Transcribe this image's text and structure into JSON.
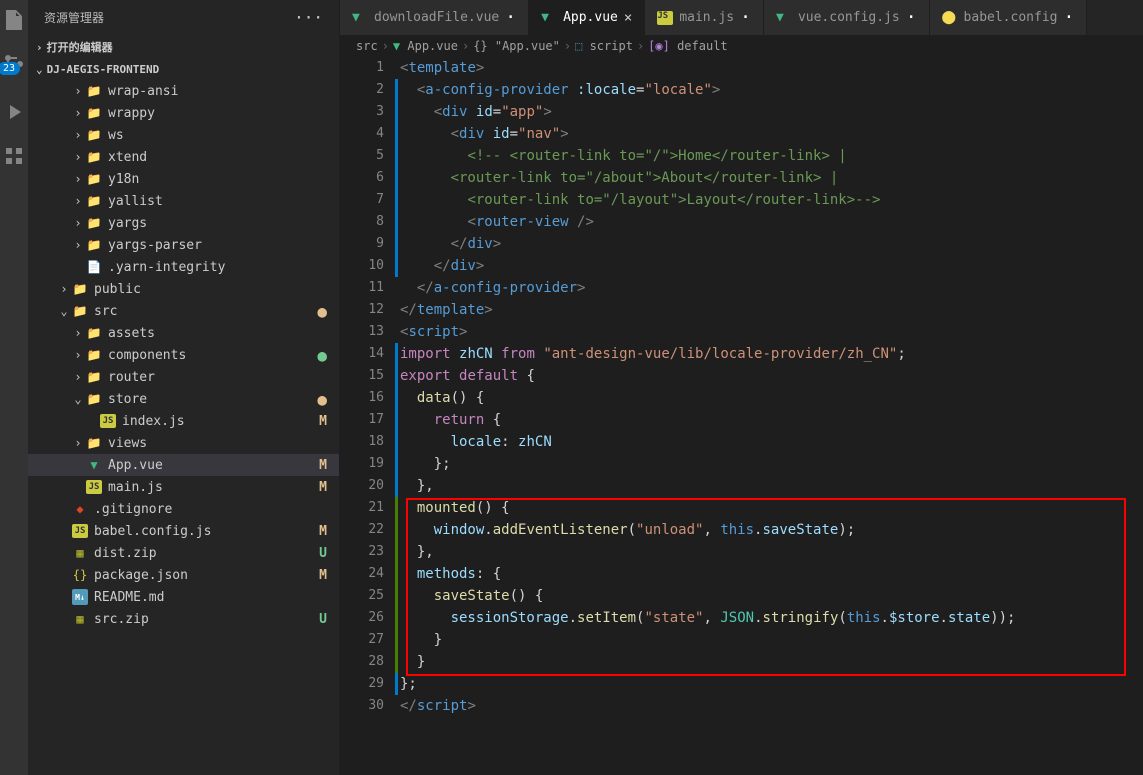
{
  "sidebar_title": "资源管理器",
  "open_editors": "打开的编辑器",
  "project": "DJ-AEGIS-FRONTEND",
  "badge": "23",
  "tree": [
    {
      "label": "wrap-ansi",
      "depth": 3,
      "chev": "›",
      "icon": "folder"
    },
    {
      "label": "wrappy",
      "depth": 3,
      "chev": "›",
      "icon": "folder"
    },
    {
      "label": "ws",
      "depth": 3,
      "chev": "›",
      "icon": "folder"
    },
    {
      "label": "xtend",
      "depth": 3,
      "chev": "›",
      "icon": "folder"
    },
    {
      "label": "y18n",
      "depth": 3,
      "chev": "›",
      "icon": "folder"
    },
    {
      "label": "yallist",
      "depth": 3,
      "chev": "›",
      "icon": "folder"
    },
    {
      "label": "yargs",
      "depth": 3,
      "chev": "›",
      "icon": "folder"
    },
    {
      "label": "yargs-parser",
      "depth": 3,
      "chev": "›",
      "icon": "folder"
    },
    {
      "label": ".yarn-integrity",
      "depth": 3,
      "chev": "",
      "icon": "file",
      "iconColor": "#519aba"
    },
    {
      "label": "public",
      "depth": 2,
      "chev": "›",
      "icon": "folder-green"
    },
    {
      "label": "src",
      "depth": 2,
      "chev": "⌄",
      "icon": "folder-green",
      "status": "dot"
    },
    {
      "label": "assets",
      "depth": 3,
      "chev": "›",
      "icon": "folder-orange"
    },
    {
      "label": "components",
      "depth": 3,
      "chev": "›",
      "icon": "folder-orange",
      "status": "gdot"
    },
    {
      "label": "router",
      "depth": 3,
      "chev": "›",
      "icon": "folder-orange"
    },
    {
      "label": "store",
      "depth": 3,
      "chev": "⌄",
      "icon": "folder-orange",
      "status": "dot"
    },
    {
      "label": "index.js",
      "depth": 4,
      "chev": "",
      "icon": "js",
      "status": "M"
    },
    {
      "label": "views",
      "depth": 3,
      "chev": "›",
      "icon": "folder-orange"
    },
    {
      "label": "App.vue",
      "depth": 3,
      "chev": "",
      "icon": "vue",
      "status": "M",
      "selected": true
    },
    {
      "label": "main.js",
      "depth": 3,
      "chev": "",
      "icon": "js",
      "status": "M"
    },
    {
      "label": ".gitignore",
      "depth": 2,
      "chev": "",
      "icon": "git"
    },
    {
      "label": "babel.config.js",
      "depth": 2,
      "chev": "",
      "icon": "js",
      "status": "M"
    },
    {
      "label": "dist.zip",
      "depth": 2,
      "chev": "",
      "icon": "zip",
      "status": "U"
    },
    {
      "label": "package.json",
      "depth": 2,
      "chev": "",
      "icon": "json",
      "status": "M"
    },
    {
      "label": "README.md",
      "depth": 2,
      "chev": "",
      "icon": "md"
    },
    {
      "label": "src.zip",
      "depth": 2,
      "chev": "",
      "icon": "zip",
      "status": "U"
    }
  ],
  "tabs": [
    {
      "label": "downloadFile.vue",
      "icon": "vue"
    },
    {
      "label": "App.vue",
      "icon": "vue",
      "active": true
    },
    {
      "label": "main.js",
      "icon": "js"
    },
    {
      "label": "vue.config.js",
      "icon": "vue"
    },
    {
      "label": "babel.config",
      "icon": "babel"
    }
  ],
  "breadcrumb": [
    "src",
    "App.vue",
    "{} \"App.vue\"",
    "script",
    "default"
  ],
  "code_lines": [
    {
      "n": 1,
      "bar": "",
      "html": "<span class='pun'>&lt;</span><span class='tag'>template</span><span class='pun'>&gt;</span>"
    },
    {
      "n": 2,
      "bar": "bl",
      "html": "  <span class='pun'>&lt;</span><span class='tag'>a-config-provider</span> <span class='attr'>:locale</span><span class='op'>=</span><span class='str'>\"locale\"</span><span class='pun'>&gt;</span>"
    },
    {
      "n": 3,
      "bar": "bl",
      "html": "    <span class='pun'>&lt;</span><span class='tag'>div</span> <span class='attr'>id</span><span class='op'>=</span><span class='str'>\"app\"</span><span class='pun'>&gt;</span>"
    },
    {
      "n": 4,
      "bar": "bl",
      "html": "      <span class='pun'>&lt;</span><span class='tag'>div</span> <span class='attr'>id</span><span class='op'>=</span><span class='str'>\"nav\"</span><span class='pun'>&gt;</span>"
    },
    {
      "n": 5,
      "bar": "bl",
      "html": "        <span class='cmt'>&lt;!-- &lt;router-link to=\"/\"&gt;Home&lt;/router-link&gt; |</span>"
    },
    {
      "n": 6,
      "bar": "bl",
      "html": "      <span class='cmt'>&lt;router-link to=\"/about\"&gt;About&lt;/router-link&gt; |</span>"
    },
    {
      "n": 7,
      "bar": "bl",
      "html": "        <span class='cmt'>&lt;router-link to=\"/layout\"&gt;Layout&lt;/router-link&gt;--&gt;</span>"
    },
    {
      "n": 8,
      "bar": "bl",
      "html": "        <span class='pun'>&lt;</span><span class='tag'>router-view</span> <span class='pun'>/&gt;</span>"
    },
    {
      "n": 9,
      "bar": "bl",
      "html": "      <span class='pun'>&lt;/</span><span class='tag'>div</span><span class='pun'>&gt;</span>"
    },
    {
      "n": 10,
      "bar": "bl",
      "html": "    <span class='pun'>&lt;/</span><span class='tag'>div</span><span class='pun'>&gt;</span>"
    },
    {
      "n": 11,
      "bar": "",
      "html": "  <span class='pun'>&lt;/</span><span class='tag'>a-config-provider</span><span class='pun'>&gt;</span>"
    },
    {
      "n": 12,
      "bar": "",
      "html": "<span class='pun'>&lt;/</span><span class='tag'>template</span><span class='pun'>&gt;</span>"
    },
    {
      "n": 13,
      "bar": "",
      "html": "<span class='pun'>&lt;</span><span class='tag'>script</span><span class='pun'>&gt;</span>"
    },
    {
      "n": 14,
      "bar": "bl",
      "html": "<span class='kw'>import</span> <span class='var'>zhCN</span> <span class='kw'>from</span> <span class='str'>\"ant-design-vue/lib/locale-provider/zh_CN\"</span><span class='op'>;</span>"
    },
    {
      "n": 15,
      "bar": "bl",
      "html": "<span class='kw'>export</span> <span class='kw'>default</span> <span class='op'>{</span>"
    },
    {
      "n": 16,
      "bar": "bl",
      "html": "  <span class='fn'>data</span><span class='op'>() {</span>"
    },
    {
      "n": 17,
      "bar": "bl",
      "html": "    <span class='kw'>return</span> <span class='op'>{</span>"
    },
    {
      "n": 18,
      "bar": "bl",
      "html": "      <span class='var'>locale</span><span class='op'>:</span> <span class='var'>zhCN</span>"
    },
    {
      "n": 19,
      "bar": "bl",
      "html": "    <span class='op'>};</span>"
    },
    {
      "n": 20,
      "bar": "bl",
      "html": "  <span class='op'>},</span>"
    },
    {
      "n": 21,
      "bar": "gr",
      "html": "  <span class='fn'>mounted</span><span class='op'>() {</span>"
    },
    {
      "n": 22,
      "bar": "gr",
      "html": "    <span class='var'>window</span><span class='op'>.</span><span class='fn'>addEventListener</span><span class='op'>(</span><span class='str'>\"unload\"</span><span class='op'>, </span><span class='kw2'>this</span><span class='op'>.</span><span class='var'>saveState</span><span class='op'>);</span>"
    },
    {
      "n": 23,
      "bar": "gr",
      "html": "  <span class='op'>},</span>"
    },
    {
      "n": 24,
      "bar": "gr",
      "html": "  <span class='var'>methods</span><span class='op'>: {</span>"
    },
    {
      "n": 25,
      "bar": "gr",
      "html": "    <span class='fn'>saveState</span><span class='op'>() {</span>"
    },
    {
      "n": 26,
      "bar": "gr",
      "html": "      <span class='var'>sessionStorage</span><span class='op'>.</span><span class='fn'>setItem</span><span class='op'>(</span><span class='str'>\"state\"</span><span class='op'>, </span><span class='cls'>JSON</span><span class='op'>.</span><span class='fn'>stringify</span><span class='op'>(</span><span class='kw2'>this</span><span class='op'>.</span><span class='var'>$store</span><span class='op'>.</span><span class='var'>state</span><span class='op'>));</span>"
    },
    {
      "n": 27,
      "bar": "gr",
      "html": "    <span class='op'>}</span>"
    },
    {
      "n": 28,
      "bar": "gr",
      "html": "  <span class='op'>}</span>"
    },
    {
      "n": 29,
      "bar": "bl",
      "html": "<span class='op'>};</span>"
    },
    {
      "n": 30,
      "bar": "",
      "html": "<span class='pun'>&lt;/</span><span class='tag'>script</span><span class='pun'>&gt;</span>"
    }
  ]
}
